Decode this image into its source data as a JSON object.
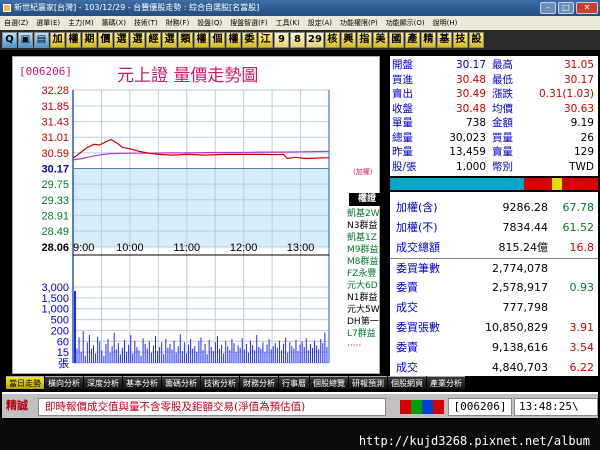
{
  "window": {
    "title": "新世紀贏家[台灣] - 103/12/29 - 台豐優股走勢 : 綜合自選股[名當股]"
  },
  "menu": [
    "自選(Z)",
    "選單(E)",
    "主力(M)",
    "籌碼(X)",
    "技術(T)",
    "財務(F)",
    "設盤(Q)",
    "搜盤智選(F)",
    "工具(K)",
    "設定(A)",
    "功能權限(P)",
    "功能顯示(O)",
    "說明(H)"
  ],
  "toolbar": [
    "Q",
    "▣",
    "▤",
    "加",
    "權",
    "期",
    "價",
    "選",
    "選",
    "經",
    "選",
    "類",
    "權",
    "個",
    "權",
    "委",
    "江",
    "9",
    "8",
    "29",
    "核",
    "興",
    "指",
    "美",
    "國",
    "產",
    "精",
    "基",
    "技",
    "設"
  ],
  "toolbar_kinds": [
    "ic",
    "ic",
    "ic",
    "",
    "",
    "",
    "",
    "",
    "",
    "",
    "",
    "",
    "",
    "",
    "",
    "",
    "",
    "num",
    "num",
    "num",
    "",
    "",
    "",
    "",
    "",
    "",
    "",
    "",
    "",
    ""
  ],
  "colors": {
    "pink": "#d0186a",
    "blue": "#0000cc",
    "red": "#cc0000",
    "green": "#007a28",
    "price_line": "#cc0000",
    "avg_line": "#b040c0",
    "volume": "#1e28ff",
    "grid": "#b9cde0",
    "ref_band": "#d6ecf8",
    "axis_blue": "#1f5fb0"
  },
  "chart": {
    "symbol": "[006206]",
    "title": "元上證  量價走勢圖",
    "plus_label": "(加權)",
    "broker_header": "權證"
  },
  "chart_data": {
    "type": "line",
    "x_ticks": [
      "9:00",
      "10:00",
      "11:00",
      "12:00",
      "13:00"
    ],
    "x_minutes": [
      0,
      60,
      120,
      180,
      240
    ],
    "x_range": [
      0,
      270
    ],
    "price_ticks_red": [
      "32.28",
      "31.85",
      "31.43",
      "31.01",
      "30.59"
    ],
    "price_tick_ref": "30.17",
    "price_ticks_green": [
      "29.75",
      "29.33",
      "28.91",
      "28.49",
      "28.06"
    ],
    "price_tick_values": [
      32.28,
      31.85,
      31.43,
      31.01,
      30.59,
      30.17,
      29.75,
      29.33,
      28.91,
      28.49,
      28.06
    ],
    "ylim": [
      28.06,
      32.28
    ],
    "volume_ticks": [
      "3,000",
      "1,500",
      "1,000",
      "500",
      "200",
      "60",
      "15",
      "張"
    ],
    "series": [
      {
        "values": [
          [
            0,
            30.45
          ],
          [
            6,
            30.56
          ],
          [
            14,
            30.72
          ],
          [
            22,
            30.82
          ],
          [
            28,
            30.8
          ],
          [
            34,
            30.88
          ],
          [
            40,
            30.95
          ],
          [
            46,
            30.86
          ],
          [
            52,
            30.74
          ],
          [
            60,
            30.7
          ],
          [
            70,
            30.63
          ],
          [
            80,
            30.58
          ],
          [
            90,
            30.55
          ],
          [
            105,
            30.53
          ],
          [
            120,
            30.55
          ],
          [
            140,
            30.53
          ],
          [
            160,
            30.55
          ],
          [
            180,
            30.55
          ],
          [
            200,
            30.55
          ],
          [
            215,
            30.54
          ],
          [
            222,
            30.55
          ],
          [
            226,
            30.44
          ],
          [
            234,
            30.47
          ],
          [
            246,
            30.44
          ],
          [
            256,
            30.45
          ],
          [
            270,
            30.46
          ]
        ]
      },
      {
        "values": [
          [
            0,
            30.4
          ],
          [
            10,
            30.44
          ],
          [
            20,
            30.5
          ],
          [
            30,
            30.54
          ],
          [
            40,
            30.57
          ],
          [
            60,
            30.58
          ],
          [
            80,
            30.58
          ],
          [
            100,
            30.59
          ],
          [
            120,
            30.59
          ],
          [
            150,
            30.6
          ],
          [
            180,
            30.6
          ],
          [
            200,
            30.61
          ],
          [
            220,
            30.61
          ],
          [
            240,
            30.62
          ],
          [
            270,
            30.63
          ]
        ]
      }
    ],
    "volume": {
      "first": 3000,
      "bars": [
        180,
        320,
        140,
        400,
        90,
        260,
        350,
        180,
        220,
        120,
        330,
        270,
        160,
        90,
        240,
        300,
        130,
        210,
        380,
        170,
        250,
        110,
        190,
        290,
        140,
        230,
        350,
        120,
        280,
        200,
        160,
        90,
        310,
        240,
        180,
        270,
        130,
        220,
        340,
        150,
        200,
        260,
        110,
        300,
        190,
        240,
        170,
        280,
        130,
        210,
        360,
        150,
        260,
        120,
        230,
        300,
        180,
        210,
        140,
        270,
        320,
        160,
        240,
        110,
        290,
        200,
        150,
        260,
        340,
        180,
        230,
        120,
        280,
        210,
        160,
        300,
        250,
        140,
        220,
        190,
        310,
        170,
        240,
        130,
        280,
        220,
        160,
        350,
        200,
        180,
        260,
        140,
        230,
        300,
        170,
        210,
        250,
        190,
        280,
        160,
        240,
        320,
        130,
        260,
        210,
        180,
        290,
        150,
        230,
        270,
        200,
        310,
        160,
        240,
        190,
        280,
        220,
        170,
        300,
        250,
        380,
        200
      ]
    }
  },
  "brokers": [
    {
      "name": "凱基2W",
      "color": "#007a28"
    },
    {
      "name": "N3群益",
      "color": "#000000"
    },
    {
      "name": "凱基1Z",
      "color": "#007a28"
    },
    {
      "name": "M9群益",
      "color": "#007a28"
    },
    {
      "name": "M8群益",
      "color": "#007a28"
    },
    {
      "name": "FZ永豐",
      "color": "#007a28"
    },
    {
      "name": "元大6D",
      "color": "#007a28"
    },
    {
      "name": "N1群益",
      "color": "#000000"
    },
    {
      "name": "元大5W",
      "color": "#000000"
    },
    {
      "name": "DH第一",
      "color": "#000000"
    },
    {
      "name": "L7群益",
      "color": "#007a28"
    },
    {
      "name": "·····",
      "color": "#d0186a"
    }
  ],
  "quote": {
    "rows": [
      {
        "l1": "開盤",
        "v1": "30.17",
        "c1": "#0000cc",
        "l2": "最高",
        "v2": "31.05",
        "c2": "#cc0000"
      },
      {
        "l1": "買進",
        "v1": "30.48",
        "c1": "#cc0000",
        "l2": "最低",
        "v2": "30.17",
        "c2": "#cc0000"
      },
      {
        "l1": "賣出",
        "v1": "30.49",
        "c1": "#cc0000",
        "l2": "漲跌",
        "v2": "0.31(1.03)",
        "c2": "#cc0000"
      },
      {
        "l1": "收盤",
        "v1": "30.48",
        "c1": "#cc0000",
        "l2": "均價",
        "v2": "30.63",
        "c2": "#cc0000"
      },
      {
        "l1": "單量",
        "v1": "738",
        "c1": "#000000",
        "l2": "金額",
        "v2": "9.19",
        "c2": "#000000"
      },
      {
        "l1": "總量",
        "v1": "30,023",
        "c1": "#000000",
        "l2": "買量",
        "v2": "26",
        "c2": "#000000"
      },
      {
        "l1": "昨量",
        "v1": "13,459",
        "c1": "#000000",
        "l2": "賣量",
        "v2": "129",
        "c2": "#000000"
      },
      {
        "l1": "股/張",
        "v1": "1,000",
        "c1": "#000000",
        "l2": "幣別",
        "v2": "TWD",
        "c2": "#000000"
      }
    ]
  },
  "info": {
    "rows": [
      {
        "label": "加權(含)",
        "value": "9286.28",
        "extra": "67.78",
        "lc": "#0000cc",
        "vc": "#000000",
        "ec": "#007a28"
      },
      {
        "label": "加權(不)",
        "value": "7834.44",
        "extra": "61.52",
        "lc": "#0000cc",
        "vc": "#000000",
        "ec": "#007a28"
      },
      {
        "label": "成交總額",
        "value": "815.24億",
        "extra": "16.8",
        "lc": "#0000cc",
        "vc": "#000000",
        "ec": "#cc0000"
      },
      {
        "label": "委買筆數",
        "value": "2,774,078",
        "extra": "",
        "lc": "#0000cc",
        "vc": "#000000",
        "ec": "#000000"
      },
      {
        "label": "委賣",
        "value": "2,578,917",
        "extra": "0.93",
        "lc": "#0000cc",
        "vc": "#000000",
        "ec": "#007a28"
      },
      {
        "label": "成交",
        "value": "777,798",
        "extra": "",
        "lc": "#0000cc",
        "vc": "#000000",
        "ec": "#000000"
      },
      {
        "label": "委買張數",
        "value": "10,850,829",
        "extra": "3.91",
        "lc": "#0000cc",
        "vc": "#000000",
        "ec": "#cc0000"
      },
      {
        "label": "委賣",
        "value": "9,138,616",
        "extra": "3.54",
        "lc": "#0000cc",
        "vc": "#000000",
        "ec": "#cc0000"
      },
      {
        "label": "成交",
        "value": "4,840,703",
        "extra": "6.22",
        "lc": "#0000cc",
        "vc": "#000000",
        "ec": "#cc0000"
      }
    ]
  },
  "tabs": [
    "當日走勢",
    "橫向分析",
    "深度分析",
    "基本分析",
    "籌碼分析",
    "技術分析",
    "財務分析",
    "行事曆",
    "個股總覽",
    "研報預測",
    "個股網頁",
    "產業分析"
  ],
  "status": {
    "label": "精誠",
    "message": "即時報價成交值與量不含零股及鉅額交易(淨值為預估值)",
    "code": "[006206]",
    "time": "13:48:25\\"
  },
  "watermark": "http://kujd3268.pixnet.net/album"
}
